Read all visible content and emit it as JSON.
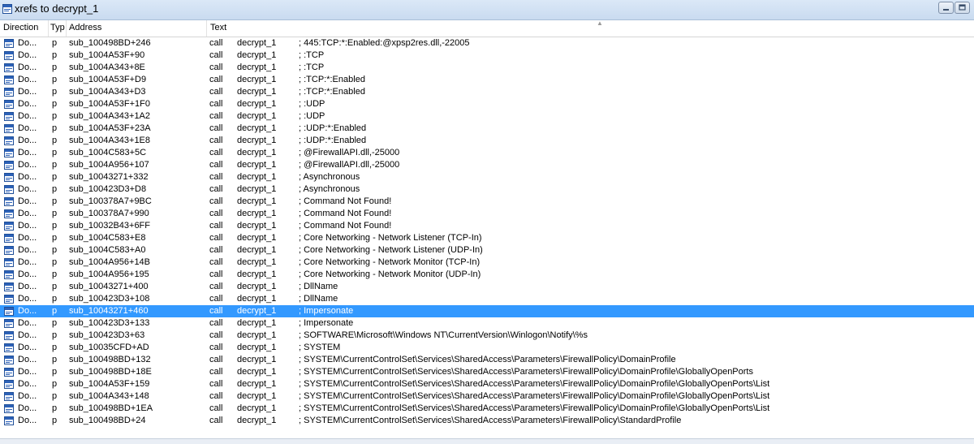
{
  "window": {
    "title": "xrefs to decrypt_1"
  },
  "columns": {
    "direction": "Direction",
    "type": "Typ",
    "address": "Address",
    "text": "Text"
  },
  "selected_index": 22,
  "rows": [
    {
      "dir": "Do...",
      "type": "p",
      "address": "sub_100498BD+246",
      "ins": "call",
      "target": "decrypt_1",
      "comment": "; 445:TCP:*:Enabled:@xpsp2res.dll,-22005"
    },
    {
      "dir": "Do...",
      "type": "p",
      "address": "sub_1004A53F+90",
      "ins": "call",
      "target": "decrypt_1",
      "comment": "; :TCP"
    },
    {
      "dir": "Do...",
      "type": "p",
      "address": "sub_1004A343+8E",
      "ins": "call",
      "target": "decrypt_1",
      "comment": "; :TCP"
    },
    {
      "dir": "Do...",
      "type": "p",
      "address": "sub_1004A53F+D9",
      "ins": "call",
      "target": "decrypt_1",
      "comment": "; :TCP:*:Enabled"
    },
    {
      "dir": "Do...",
      "type": "p",
      "address": "sub_1004A343+D3",
      "ins": "call",
      "target": "decrypt_1",
      "comment": "; :TCP:*:Enabled"
    },
    {
      "dir": "Do...",
      "type": "p",
      "address": "sub_1004A53F+1F0",
      "ins": "call",
      "target": "decrypt_1",
      "comment": "; :UDP"
    },
    {
      "dir": "Do...",
      "type": "p",
      "address": "sub_1004A343+1A2",
      "ins": "call",
      "target": "decrypt_1",
      "comment": "; :UDP"
    },
    {
      "dir": "Do...",
      "type": "p",
      "address": "sub_1004A53F+23A",
      "ins": "call",
      "target": "decrypt_1",
      "comment": "; :UDP:*:Enabled"
    },
    {
      "dir": "Do...",
      "type": "p",
      "address": "sub_1004A343+1E8",
      "ins": "call",
      "target": "decrypt_1",
      "comment": "; :UDP:*:Enabled"
    },
    {
      "dir": "Do...",
      "type": "p",
      "address": "sub_1004C583+5C",
      "ins": "call",
      "target": "decrypt_1",
      "comment": "; @FirewallAPI.dll,-25000"
    },
    {
      "dir": "Do...",
      "type": "p",
      "address": "sub_1004A956+107",
      "ins": "call",
      "target": "decrypt_1",
      "comment": "; @FirewallAPI.dll,-25000"
    },
    {
      "dir": "Do...",
      "type": "p",
      "address": "sub_10043271+332",
      "ins": "call",
      "target": "decrypt_1",
      "comment": "; Asynchronous"
    },
    {
      "dir": "Do...",
      "type": "p",
      "address": "sub_100423D3+D8",
      "ins": "call",
      "target": "decrypt_1",
      "comment": "; Asynchronous"
    },
    {
      "dir": "Do...",
      "type": "p",
      "address": "sub_100378A7+9BC",
      "ins": "call",
      "target": "decrypt_1",
      "comment": "; Command Not Found!"
    },
    {
      "dir": "Do...",
      "type": "p",
      "address": "sub_100378A7+990",
      "ins": "call",
      "target": "decrypt_1",
      "comment": "; Command Not Found!"
    },
    {
      "dir": "Do...",
      "type": "p",
      "address": "sub_10032B43+6FF",
      "ins": "call",
      "target": "decrypt_1",
      "comment": "; Command Not Found!"
    },
    {
      "dir": "Do...",
      "type": "p",
      "address": "sub_1004C583+E8",
      "ins": "call",
      "target": "decrypt_1",
      "comment": "; Core Networking - Network Listener (TCP-In)"
    },
    {
      "dir": "Do...",
      "type": "p",
      "address": "sub_1004C583+A0",
      "ins": "call",
      "target": "decrypt_1",
      "comment": "; Core Networking - Network Listener (UDP-In)"
    },
    {
      "dir": "Do...",
      "type": "p",
      "address": "sub_1004A956+14B",
      "ins": "call",
      "target": "decrypt_1",
      "comment": "; Core Networking - Network Monitor (TCP-In)"
    },
    {
      "dir": "Do...",
      "type": "p",
      "address": "sub_1004A956+195",
      "ins": "call",
      "target": "decrypt_1",
      "comment": "; Core Networking - Network Monitor (UDP-In)"
    },
    {
      "dir": "Do...",
      "type": "p",
      "address": "sub_10043271+400",
      "ins": "call",
      "target": "decrypt_1",
      "comment": "; DllName"
    },
    {
      "dir": "Do...",
      "type": "p",
      "address": "sub_100423D3+108",
      "ins": "call",
      "target": "decrypt_1",
      "comment": "; DllName"
    },
    {
      "dir": "Do...",
      "type": "p",
      "address": "sub_10043271+460",
      "ins": "call",
      "target": "decrypt_1",
      "comment": "; Impersonate"
    },
    {
      "dir": "Do...",
      "type": "p",
      "address": "sub_100423D3+133",
      "ins": "call",
      "target": "decrypt_1",
      "comment": "; Impersonate"
    },
    {
      "dir": "Do...",
      "type": "p",
      "address": "sub_100423D3+63",
      "ins": "call",
      "target": "decrypt_1",
      "comment": "; SOFTWARE\\Microsoft\\Windows NT\\CurrentVersion\\Winlogon\\Notify\\%s"
    },
    {
      "dir": "Do...",
      "type": "p",
      "address": "sub_10035CFD+AD",
      "ins": "call",
      "target": "decrypt_1",
      "comment": "; SYSTEM"
    },
    {
      "dir": "Do...",
      "type": "p",
      "address": "sub_100498BD+132",
      "ins": "call",
      "target": "decrypt_1",
      "comment": "; SYSTEM\\CurrentControlSet\\Services\\SharedAccess\\Parameters\\FirewallPolicy\\DomainProfile"
    },
    {
      "dir": "Do...",
      "type": "p",
      "address": "sub_100498BD+18E",
      "ins": "call",
      "target": "decrypt_1",
      "comment": "; SYSTEM\\CurrentControlSet\\Services\\SharedAccess\\Parameters\\FirewallPolicy\\DomainProfile\\GloballyOpenPorts"
    },
    {
      "dir": "Do...",
      "type": "p",
      "address": "sub_1004A53F+159",
      "ins": "call",
      "target": "decrypt_1",
      "comment": "; SYSTEM\\CurrentControlSet\\Services\\SharedAccess\\Parameters\\FirewallPolicy\\DomainProfile\\GloballyOpenPorts\\List"
    },
    {
      "dir": "Do...",
      "type": "p",
      "address": "sub_1004A343+148",
      "ins": "call",
      "target": "decrypt_1",
      "comment": "; SYSTEM\\CurrentControlSet\\Services\\SharedAccess\\Parameters\\FirewallPolicy\\DomainProfile\\GloballyOpenPorts\\List"
    },
    {
      "dir": "Do...",
      "type": "p",
      "address": "sub_100498BD+1EA",
      "ins": "call",
      "target": "decrypt_1",
      "comment": "; SYSTEM\\CurrentControlSet\\Services\\SharedAccess\\Parameters\\FirewallPolicy\\DomainProfile\\GloballyOpenPorts\\List"
    },
    {
      "dir": "Do...",
      "type": "p",
      "address": "sub_100498BD+24",
      "ins": "call",
      "target": "decrypt_1",
      "comment": "; SYSTEM\\CurrentControlSet\\Services\\SharedAccess\\Parameters\\FirewallPolicy\\StandardProfile"
    }
  ]
}
